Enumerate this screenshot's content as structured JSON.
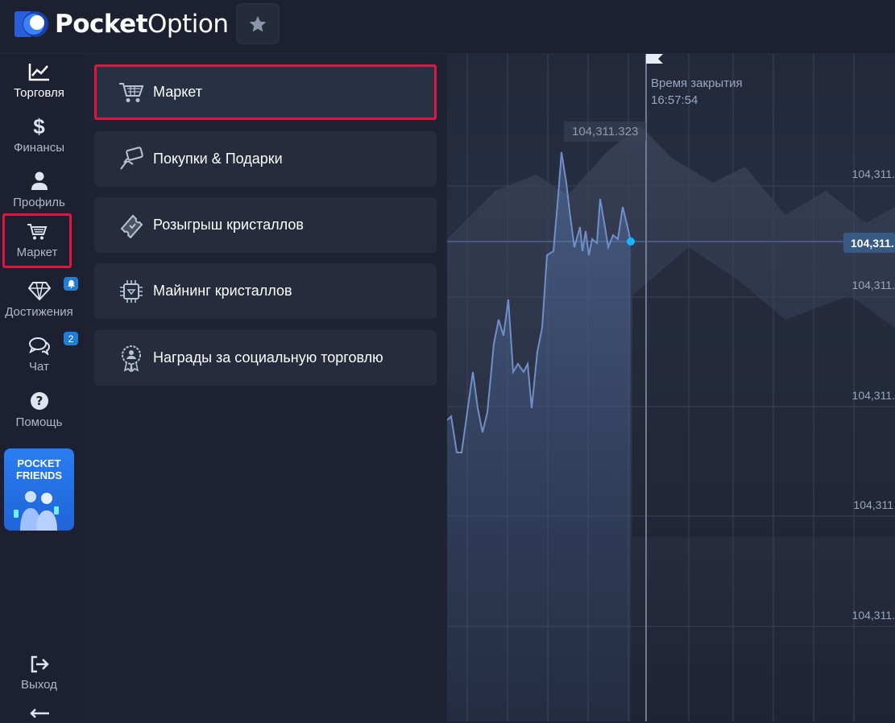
{
  "header": {
    "logo_bold": "Pocket",
    "logo_regular": "Option",
    "favorites_icon": "star-icon"
  },
  "sidebar": {
    "items": [
      {
        "label": "Торговля",
        "icon": "chart-line-icon"
      },
      {
        "label": "Финансы",
        "icon": "dollar-icon"
      },
      {
        "label": "Профиль",
        "icon": "user-icon"
      },
      {
        "label": "Маркет",
        "icon": "cart-icon"
      },
      {
        "label": "Достижения",
        "icon": "diamond-icon"
      },
      {
        "label": "Чат",
        "icon": "chat-icon"
      },
      {
        "label": "Помощь",
        "icon": "help-icon"
      },
      {
        "label": "Выход",
        "icon": "logout-icon"
      }
    ],
    "achievements_badge_icon": "bell-icon",
    "chat_badge": "2",
    "promo": {
      "line1": "POCKET",
      "line2": "FRIENDS"
    }
  },
  "menu": {
    "items": [
      {
        "label": "Маркет",
        "icon": "cart-icon"
      },
      {
        "label": "Покупки & Подарки",
        "icon": "card-hand-icon"
      },
      {
        "label": "Розыгрыш кристаллов",
        "icon": "ticket-icon"
      },
      {
        "label": "Майнинг кристаллов",
        "icon": "chip-icon"
      },
      {
        "label": "Награды за социальную торговлю",
        "icon": "award-icon"
      }
    ]
  },
  "chart": {
    "close_time_label": "Время закрытия",
    "close_time": "16:57:54",
    "peak_value": "104,311.323",
    "current_price": "104,311.",
    "price_labels": [
      "104,311.",
      "104,311.",
      "104,311.",
      "104,311",
      "104,311."
    ]
  },
  "colors": {
    "highlight": "#e0153f",
    "accent_blue": "#1f7fd6",
    "background": "#1e2232",
    "panel": "#262c3d"
  }
}
